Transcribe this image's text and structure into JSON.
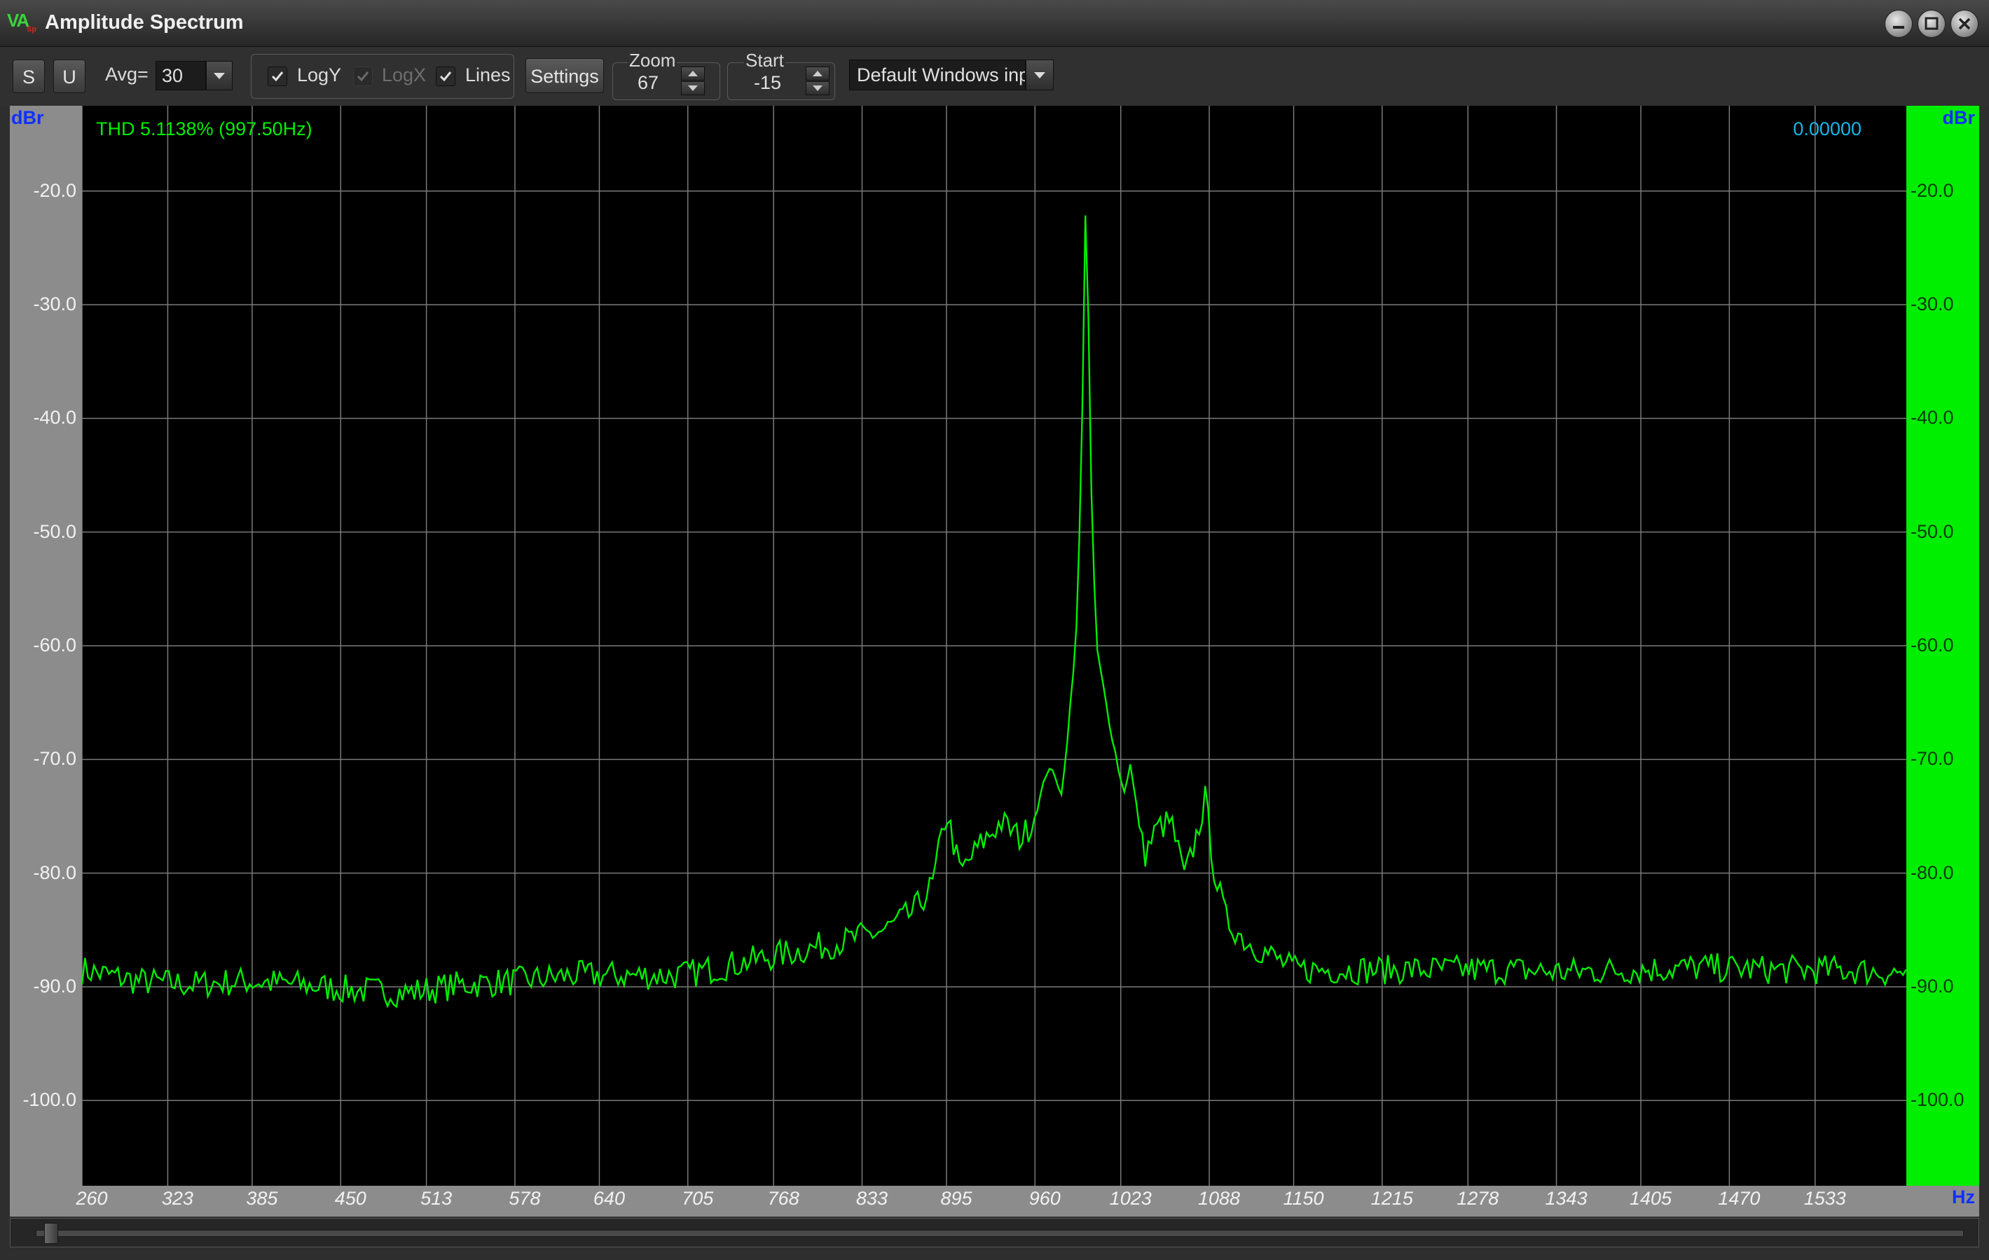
{
  "window": {
    "title": "Amplitude Spectrum",
    "icon_text": "VA",
    "icon_sub": "Sp"
  },
  "toolbar": {
    "s_label": "S",
    "u_label": "U",
    "avg_label": "Avg=",
    "avg_value": "30",
    "logy_label": "LogY",
    "logy_checked": true,
    "logx_label": "LogX",
    "logx_checked": true,
    "logx_disabled": true,
    "lines_label": "Lines",
    "lines_checked": true,
    "settings_label": "Settings",
    "zoom_label": "Zoom",
    "zoom_value": "67",
    "start_label": "Start",
    "start_value": "-15",
    "input_device": "Default Windows inp"
  },
  "plot": {
    "left_unit": "dBr",
    "right_unit": "dBr",
    "x_unit": "Hz",
    "thd_text": "THD 5.1138% (997.50Hz)",
    "readout": "0.00000",
    "colors": {
      "trace": "#00ee00",
      "grid": "#7a7a7a",
      "thd_text": "#00ee00",
      "readout": "#19b5e8",
      "unit": "#1030ff"
    }
  },
  "chart_data": {
    "type": "line",
    "title": "",
    "xlabel": "Hz",
    "ylabel": "dBr",
    "y_ticks": [
      "-20.0",
      "-30.0",
      "-40.0",
      "-50.0",
      "-60.0",
      "-70.0",
      "-80.0",
      "-90.0",
      "-100.0"
    ],
    "y_tick_values": [
      -20,
      -30,
      -40,
      -50,
      -60,
      -70,
      -80,
      -90,
      -100
    ],
    "x_ticks": [
      "260",
      "323",
      "385",
      "450",
      "513",
      "578",
      "640",
      "705",
      "768",
      "833",
      "895",
      "960",
      "1023",
      "1088",
      "1150",
      "1215",
      "1278",
      "1343",
      "1405",
      "1470",
      "1533"
    ],
    "x_tick_values": [
      260,
      323,
      385,
      450,
      513,
      578,
      640,
      705,
      768,
      833,
      895,
      960,
      1023,
      1088,
      1150,
      1215,
      1278,
      1343,
      1405,
      1470,
      1533
    ],
    "xlim": [
      260,
      1600
    ],
    "ylim": [
      -107.5,
      -12.5
    ],
    "grid": true,
    "series": [
      {
        "x": [
          260,
          300,
          340,
          380,
          420,
          460,
          500,
          540,
          580,
          620,
          660,
          700,
          740,
          780,
          820,
          850,
          870,
          885,
          895,
          905,
          920,
          935,
          950,
          960,
          970,
          980,
          990,
          994,
          997.5,
          1001,
          1005,
          1015,
          1025,
          1030,
          1040,
          1050,
          1060,
          1070,
          1078,
          1085,
          1092,
          1100,
          1115,
          1130,
          1150,
          1200,
          1250,
          1300,
          1350,
          1400,
          1450,
          1500,
          1550,
          1600
        ],
        "y": [
          -88.5,
          -89.5,
          -89.8,
          -89.5,
          -89.8,
          -90.3,
          -90.5,
          -89.8,
          -89.5,
          -89.0,
          -89.0,
          -89.0,
          -88.0,
          -87.0,
          -86.0,
          -85.0,
          -83.5,
          -81.0,
          -74.5,
          -80.0,
          -77.5,
          -75.5,
          -77.0,
          -75.0,
          -70.5,
          -73.0,
          -60.0,
          -45.0,
          -18.5,
          -45.0,
          -60.0,
          -67.0,
          -73.0,
          -70.5,
          -78.5,
          -76.0,
          -75.5,
          -80.5,
          -77.0,
          -73.5,
          -80.0,
          -84.0,
          -86.0,
          -87.0,
          -88.5,
          -88.5,
          -88.5,
          -88.5,
          -88.7,
          -88.5,
          -88.3,
          -88.5,
          -88.5,
          -88.8
        ]
      }
    ]
  }
}
